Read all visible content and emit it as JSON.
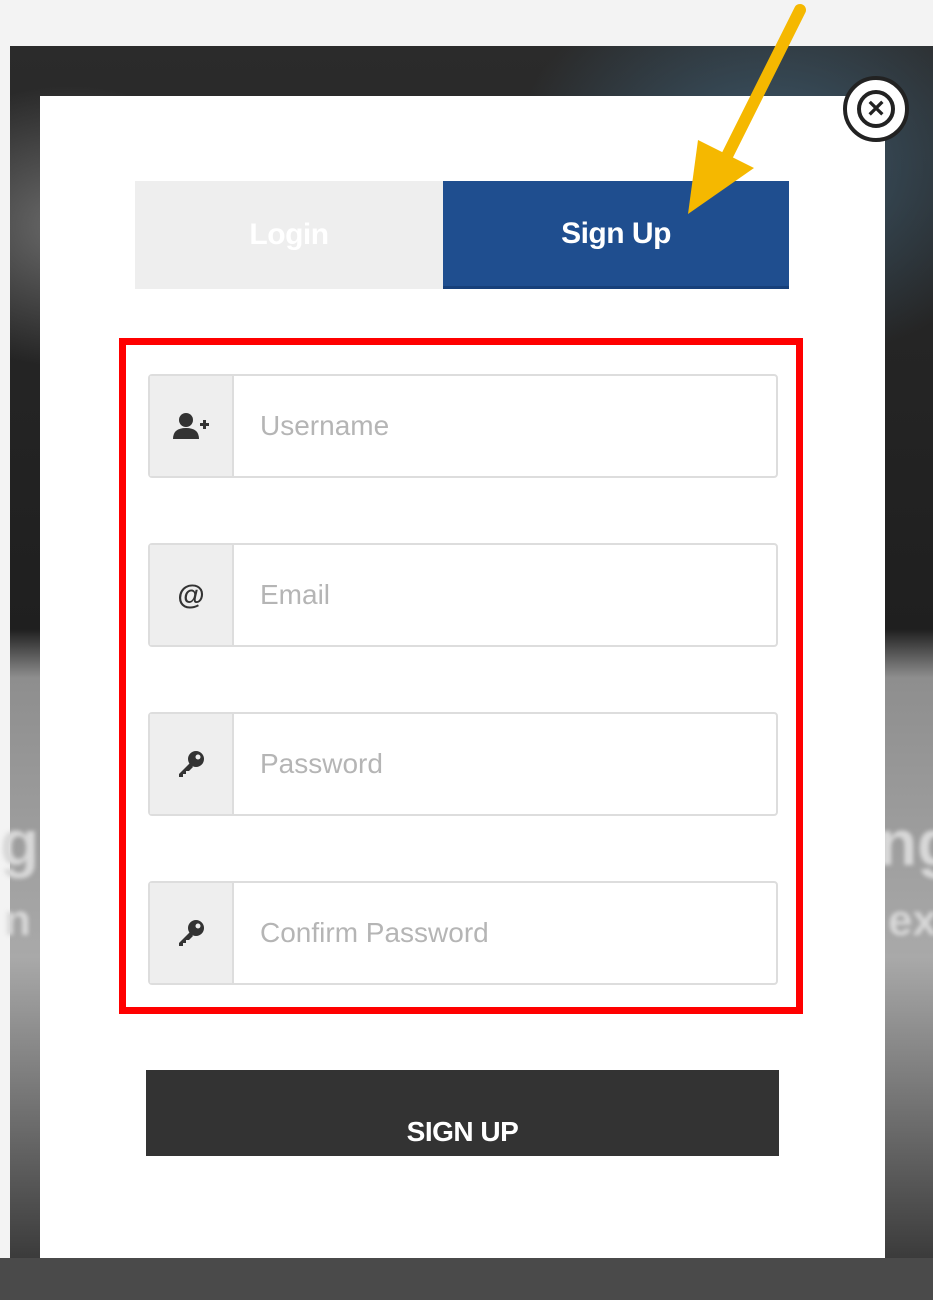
{
  "modal": {
    "close_icon": "close-circle-icon",
    "tabs": [
      {
        "label": "Login",
        "active": false
      },
      {
        "label": "Sign Up",
        "active": true
      }
    ],
    "fields": [
      {
        "icon": "add-user-icon",
        "placeholder": "Username"
      },
      {
        "icon": "at-icon",
        "icon_glyph": "@",
        "placeholder": "Email"
      },
      {
        "icon": "key-icon",
        "placeholder": "Password"
      },
      {
        "icon": "key-icon",
        "placeholder": "Confirm Password"
      }
    ],
    "submit_label": "SIGN UP"
  },
  "annotations": {
    "arrow_color": "#f5b800",
    "highlight_color": "#ff0000"
  },
  "colors": {
    "active_tab": "#1f4e8f",
    "inactive_tab": "#eeeeee",
    "submit_button": "#333333"
  }
}
